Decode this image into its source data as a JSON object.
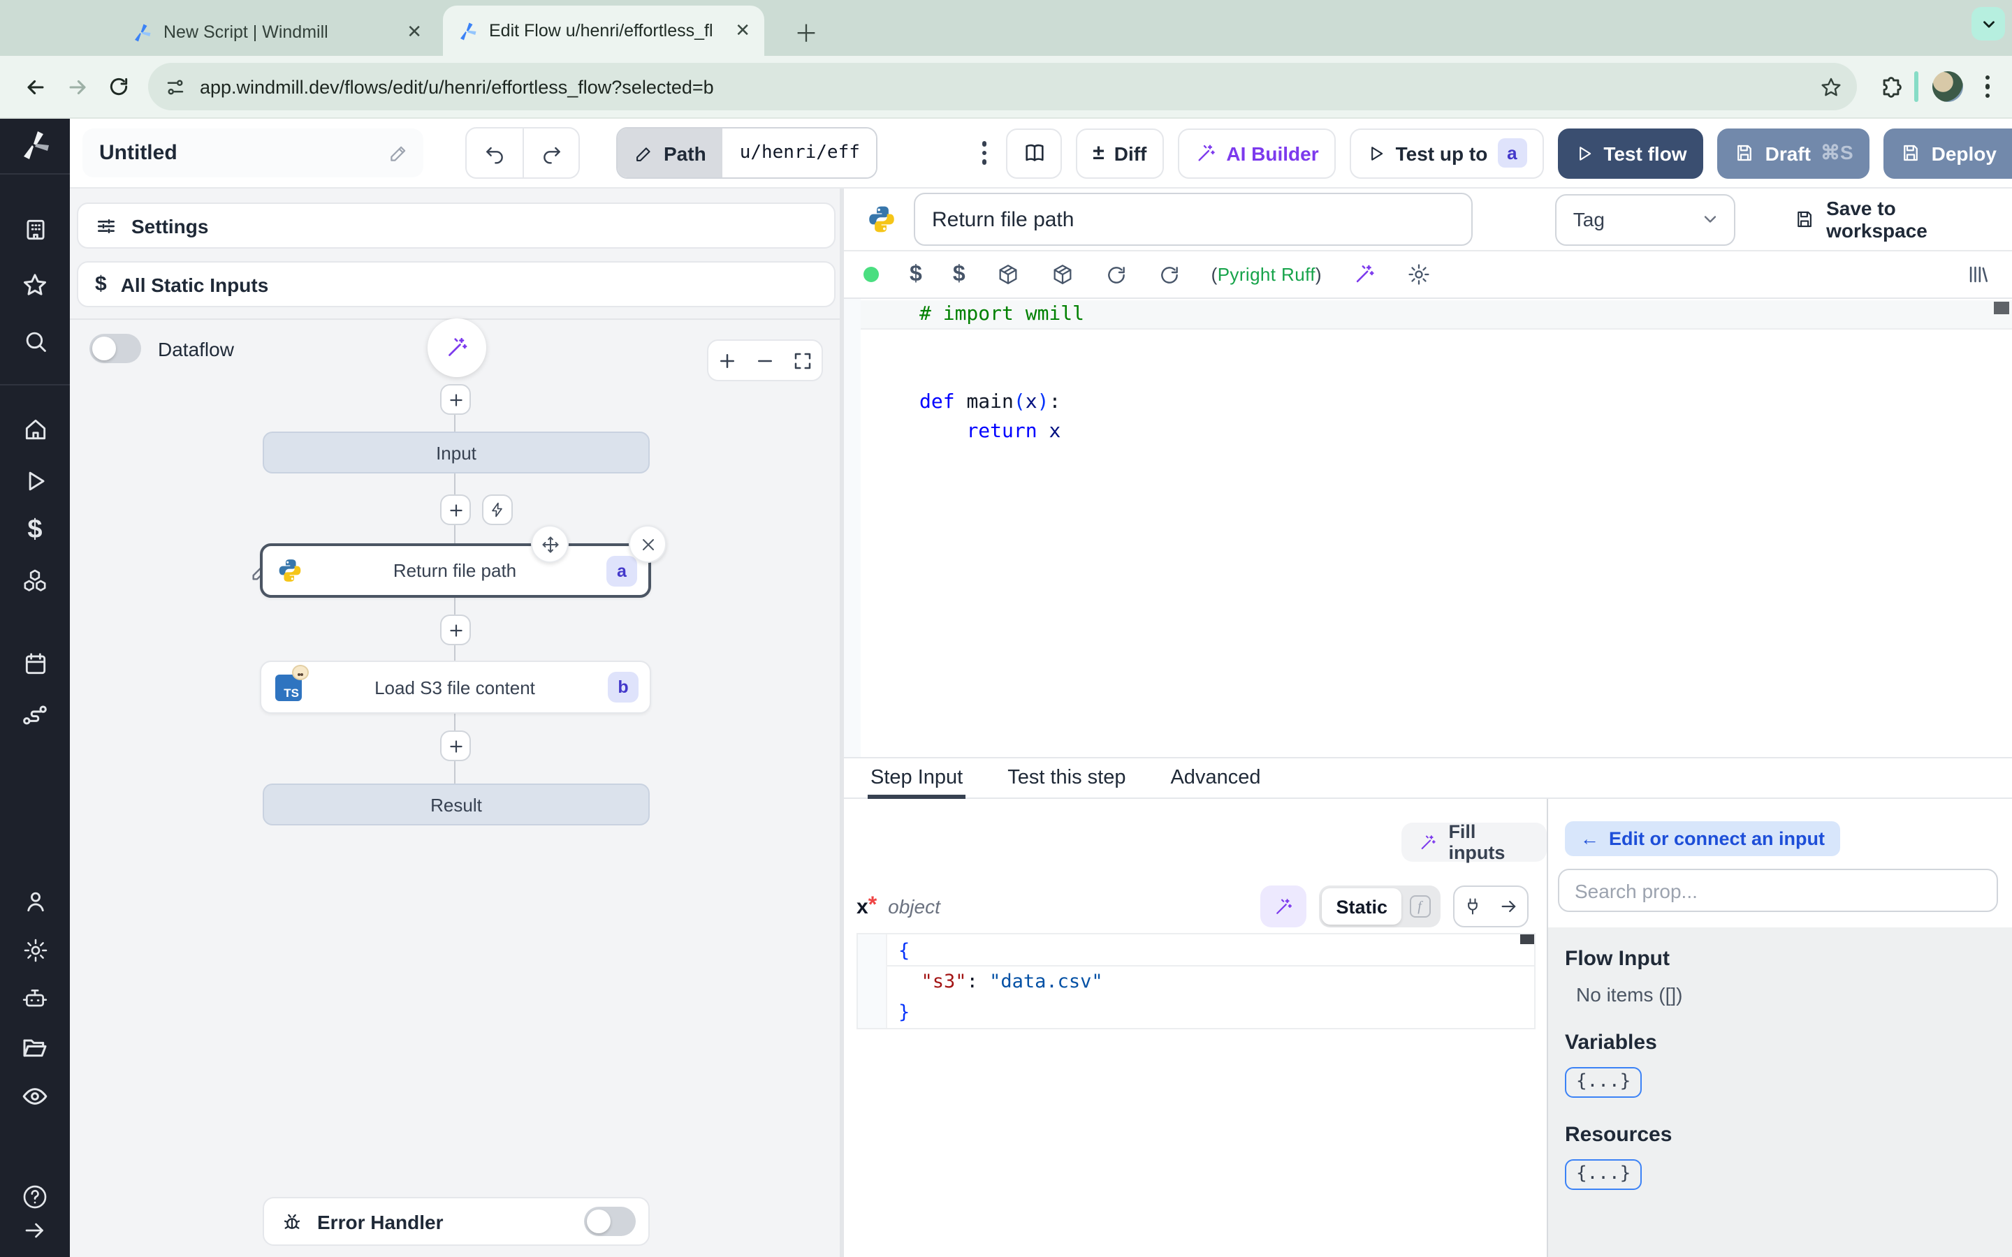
{
  "browser": {
    "tabs": [
      {
        "title": "New Script | Windmill"
      },
      {
        "title": "Edit Flow u/henri/effortless_fl"
      }
    ],
    "url": "app.windmill.dev/flows/edit/u/henri/effortless_flow?selected=b"
  },
  "app_toolbar": {
    "flow_name": "Untitled",
    "path_label": "Path",
    "path_value": "u/henri/eff",
    "diff_sign": "±",
    "diff_label": "Diff",
    "ai_builder_label": "AI Builder",
    "test_up_to_label": "Test up to",
    "test_up_to_badge": "a",
    "test_flow_label": "Test flow",
    "draft_label": "Draft",
    "draft_shortcut": "⌘S",
    "deploy_label": "Deploy"
  },
  "flow_panel": {
    "settings_label": "Settings",
    "all_static_inputs_label": "All Static Inputs",
    "dataflow_label": "Dataflow",
    "input_node_label": "Input",
    "result_node_label": "Result",
    "nodes": [
      {
        "label": "Return file path",
        "badge": "a",
        "language": "python"
      },
      {
        "label": "Load S3 file content",
        "badge": "b",
        "language": "bun-typescript"
      }
    ],
    "error_handler_label": "Error Handler"
  },
  "editor": {
    "step_title": "Return file path",
    "tag_placeholder": "Tag",
    "save_to_workspace_label": "Save to workspace",
    "lint_open": "(",
    "lint_assistants": "Pyright Ruff",
    "lint_close": ")",
    "code_tokens": [
      [
        [
          "cm",
          "# import wmill"
        ]
      ],
      [],
      [],
      [
        [
          "kw",
          "def"
        ],
        [
          "pl",
          " main"
        ],
        [
          "pr",
          "("
        ],
        [
          "vr",
          "x"
        ],
        [
          "pr",
          ")"
        ],
        [
          "pl",
          ":"
        ]
      ],
      [
        [
          "pl",
          "    "
        ],
        [
          "kw",
          "return"
        ],
        [
          "pl",
          " "
        ],
        [
          "vr",
          "x"
        ]
      ]
    ]
  },
  "step_panel": {
    "tabs": [
      "Step Input",
      "Test this step",
      "Advanced"
    ],
    "fill_inputs_label": "Fill inputs",
    "arg_name": "x",
    "arg_required_mark": "*",
    "arg_type": "object",
    "static_label": "Static",
    "json_tokens": [
      [
        [
          "pr",
          "{"
        ]
      ],
      [
        [
          "pl",
          "  "
        ],
        [
          "key",
          "\"s3\""
        ],
        [
          "pl",
          ": "
        ],
        [
          "str",
          "\"data.csv\""
        ]
      ],
      [
        [
          "pr",
          "}"
        ]
      ]
    ]
  },
  "connect_panel": {
    "back_arrow": "←",
    "edit_or_connect_label": "Edit or connect an input",
    "search_placeholder": "Search prop...",
    "flow_input_label": "Flow Input",
    "no_items_label": "No items ([])",
    "variables_label": "Variables",
    "variables_chip": "{...}",
    "resources_label": "Resources",
    "resources_chip": "{...}"
  },
  "icons": {
    "sidebar": [
      "windmill-logo",
      "workspace-icon",
      "favorites-star-icon",
      "search-icon",
      "home-icon",
      "runs-play-icon",
      "variables-dollar-icon",
      "resources-cubes-icon",
      "schedules-calendar-icon",
      "routes-icon",
      "users-icon",
      "settings-gear-icon",
      "workers-robot-icon",
      "folders-icon",
      "audit-eye-icon",
      "help-icon",
      "collapse-arrow-icon"
    ],
    "editor_toolbar": [
      "status-dot",
      "variable-dollar-icon",
      "resource-dollar-icon",
      "package-icon",
      "package-icon",
      "reload-icon",
      "reload-icon",
      "ai-wand-icon",
      "gear-icon",
      "library-icon"
    ]
  },
  "colors": {
    "chrome_bg": "#ccdcd4",
    "navbar_bg": "#edf4f0",
    "sidebar_bg": "#1d212b",
    "panel_bg": "#f3f4f6",
    "accent_purple": "#7c3aed",
    "navy_button": "#3a4e70",
    "slate_button": "#7289ab",
    "badge_bg": "#dfe3fb",
    "badge_text": "#4338ca",
    "selected_border": "#4b5563",
    "status_green": "#4ade80",
    "link_blue": "#1d4ed8"
  }
}
